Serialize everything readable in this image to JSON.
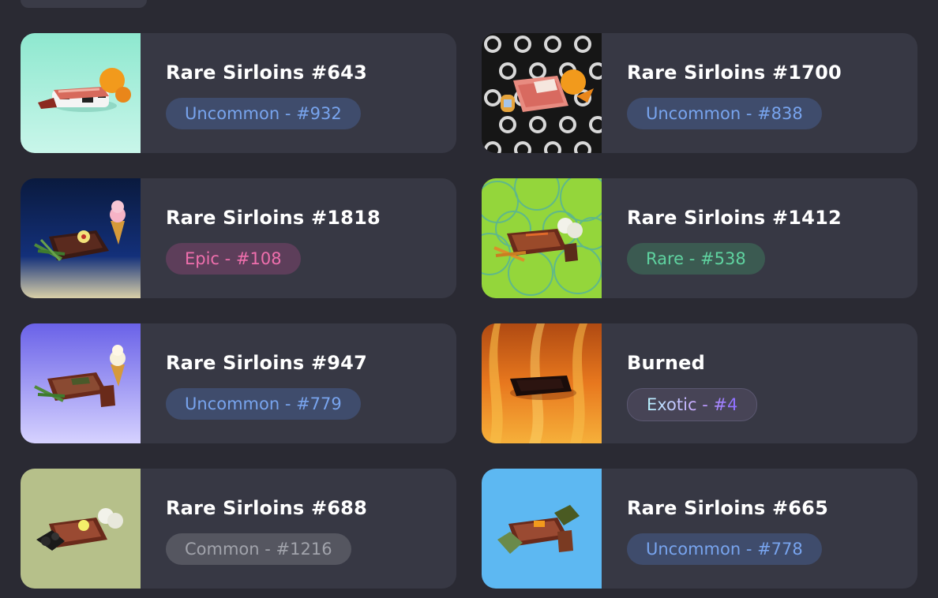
{
  "items": [
    {
      "name": "Rare Sirloins #643",
      "badge": "Uncommon - #932",
      "tier": "uncommon"
    },
    {
      "name": "Rare Sirloins #1700",
      "badge": "Uncommon - #838",
      "tier": "uncommon"
    },
    {
      "name": "Rare Sirloins #1818",
      "badge": "Epic - #108",
      "tier": "epic"
    },
    {
      "name": "Rare Sirloins #1412",
      "badge": "Rare - #538",
      "tier": "rare"
    },
    {
      "name": "Rare Sirloins #947",
      "badge": "Uncommon - #779",
      "tier": "uncommon"
    },
    {
      "name": "Burned",
      "badge": "Exotic - #4",
      "tier": "exotic"
    },
    {
      "name": "Rare Sirloins #688",
      "badge": "Common - #1216",
      "tier": "common"
    },
    {
      "name": "Rare Sirloins #665",
      "badge": "Uncommon - #778",
      "tier": "uncommon"
    }
  ],
  "colors": {
    "page_background": "#2a2a33",
    "card_background": "#373844",
    "uncommon_text": "#78a4ee",
    "epic_text": "#ef6fad",
    "rare_text": "#5fd3a0",
    "common_text": "#a1a3ab"
  }
}
